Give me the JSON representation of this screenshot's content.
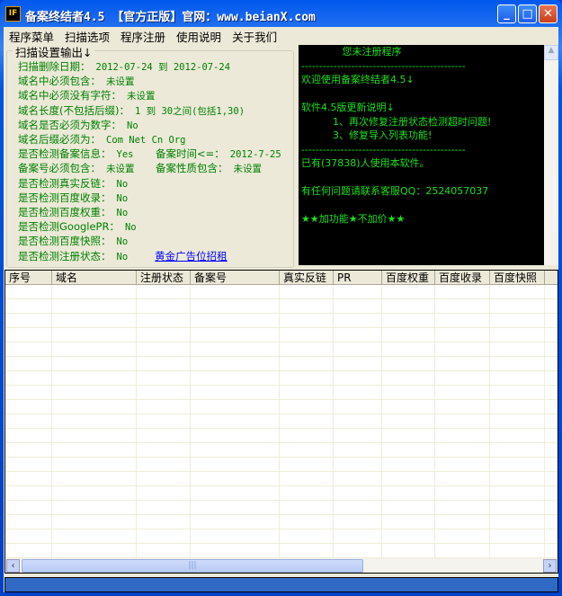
{
  "window": {
    "title": "备案终结者4.5 【官方正版】官网：www.beianX.com",
    "icon": "IF",
    "minimize": "_",
    "maximize": "□",
    "close": "✕"
  },
  "menu": [
    "程序菜单",
    "扫描选项",
    "程序注册",
    "使用说明",
    "关于我们"
  ],
  "settings": {
    "label": "扫描设置输出↓",
    "rows": [
      {
        "k": "扫描删除日期：",
        "v": "2012-07-24 到 2012-07-24"
      },
      {
        "k": "域名中必须包含：",
        "v": "未设置"
      },
      {
        "k": "域名中必须没有字符：",
        "v": "未设置"
      },
      {
        "k": "域名长度(不包括后缀)：",
        "v": "1 到 30之间(包括1,30)"
      },
      {
        "k": "域名是否必须为数字：",
        "v": "No"
      },
      {
        "k": "域名后缀必须为：",
        "v": "Com  Net  Cn  Org"
      },
      {
        "k": "是否检测备案信息：",
        "v": "Yes",
        "k2": "备案时间<=：",
        "v2": "2012-7-25"
      },
      {
        "k": "备案号必须包含：",
        "v": "未设置",
        "k2": "备案性质包含：",
        "v2": "未设置"
      },
      {
        "k": "是否检测真实反链：",
        "v": "No"
      },
      {
        "k": "是否检测百度收录：",
        "v": "No"
      },
      {
        "k": "是否检测百度权重：",
        "v": "No"
      },
      {
        "k": "是否检测GooglePR：",
        "v": "No"
      },
      {
        "k": "是否检测百度快照：",
        "v": "No"
      },
      {
        "k": "是否检测注册状态：",
        "v": "No"
      }
    ],
    "ad_link": "黄金广告位招租"
  },
  "console": {
    "lines": [
      "             您未注册程序",
      "----------------------------------------------",
      "欢迎使用备案终结者4.5↓",
      "",
      "软件4.5版更新说明↓",
      "          1、再次修复注册状态检测超时问题!",
      "          3、修复导入列表功能!",
      "----------------------------------------------",
      "已有(37838)人使用本软件。",
      "",
      "有任何问题请联系客服QQ：2524057037",
      "",
      "★★加功能★不加价★★"
    ]
  },
  "table": {
    "columns": [
      "序号",
      "域名",
      "注册状态",
      "备案号",
      "真实反链",
      "PR",
      "百度权重",
      "百度收录",
      "百度快照"
    ],
    "rows": []
  },
  "colors": {
    "console_text": "#1ee01e",
    "settings_text": "#008000",
    "status_bar": "#316ac5"
  }
}
